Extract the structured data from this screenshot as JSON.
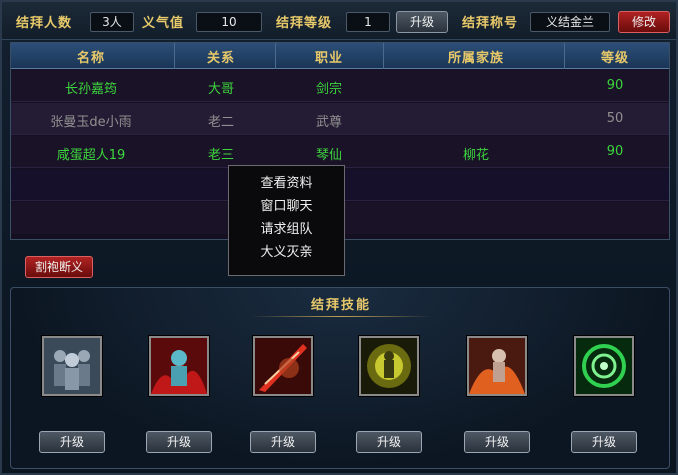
{
  "top": {
    "members_label": "结拜人数",
    "members_value": "3人",
    "loyalty_label": "义气值",
    "loyalty_value": "10",
    "level_label": "结拜等级",
    "level_value": "1",
    "upgrade_label": "升级",
    "title_label": "结拜称号",
    "title_value": "义结金兰",
    "edit_label": "修改"
  },
  "table": {
    "headers": [
      "名称",
      "关系",
      "职业",
      "所属家族",
      "等级"
    ],
    "rows": [
      {
        "name": "长孙嘉筠",
        "relation": "大哥",
        "job": "剑宗",
        "family": "",
        "level": "90",
        "online": true
      },
      {
        "name": "张曼玉de小雨",
        "relation": "老二",
        "job": "武尊",
        "family": "",
        "level": "50",
        "online": false
      },
      {
        "name": "咸蛋超人19",
        "relation": "老三",
        "job": "琴仙",
        "family": "柳花",
        "level": "90",
        "online": true
      }
    ]
  },
  "context_menu": {
    "items": [
      "查看资料",
      "窗口聊天",
      "请求组队",
      "大义灭亲"
    ]
  },
  "break_button": "割袍断义",
  "skills": {
    "title": "结拜技能",
    "upgrade_label": "升级",
    "icons": [
      "group-skill-icon",
      "flame-warrior-skill-icon",
      "blade-skill-icon",
      "golden-aura-skill-icon",
      "fire-spirit-skill-icon",
      "green-vortex-skill-icon"
    ]
  },
  "colors": {
    "gold": "#e8c96a",
    "online_green": "#3cd43c",
    "offline_grey": "#909090",
    "red_button": "#b02222"
  }
}
